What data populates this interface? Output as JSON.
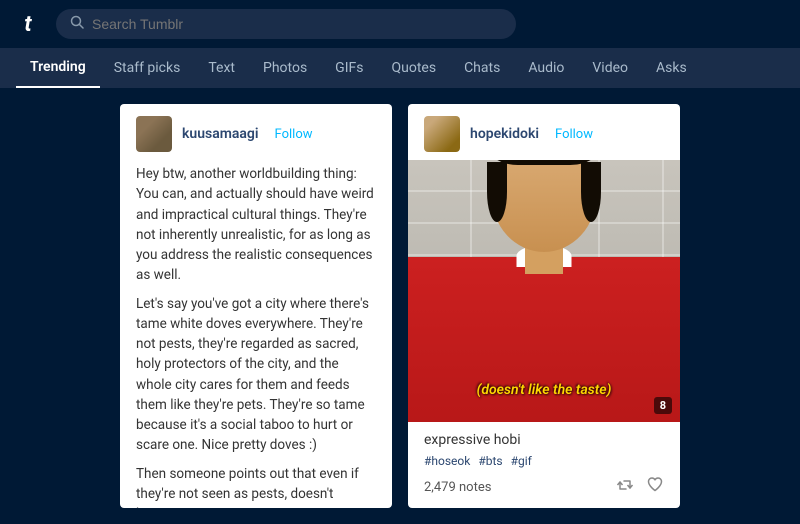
{
  "topbar": {
    "logo": "t",
    "search_placeholder": "Search Tumblr"
  },
  "nav": {
    "items": [
      {
        "label": "Trending",
        "active": true
      },
      {
        "label": "Staff picks",
        "active": false
      },
      {
        "label": "Text",
        "active": false
      },
      {
        "label": "Photos",
        "active": false
      },
      {
        "label": "GIFs",
        "active": false
      },
      {
        "label": "Quotes",
        "active": false
      },
      {
        "label": "Chats",
        "active": false
      },
      {
        "label": "Audio",
        "active": false
      },
      {
        "label": "Video",
        "active": false
      },
      {
        "label": "Asks",
        "active": false
      }
    ]
  },
  "posts": [
    {
      "id": "kuusamaagi-post",
      "username": "kuusamaagi",
      "follow_label": "Follow",
      "paragraphs": [
        "Hey btw, another worldbuilding thing: You can, and actually should have weird and impractical cultural things. They're not inherently unrealistic, for as long as you address the realistic consequences as well.",
        "Let's say you've got a city where there's tame white doves everywhere. They're not pests, they're regarded as sacred, holy protectors of the city, and the whole city cares for them and feeds them like they're pets. They're so tame because it's a social taboo to hurt or scare one. Nice pretty doves :)",
        "Then someone points out that even if they're not seen as pests, doesn't having a"
      ]
    },
    {
      "id": "hopekidoki-post",
      "username": "hopekidoki",
      "follow_label": "Follow",
      "caption": "(doesn't like the taste)",
      "gif_badge": "8",
      "post_title": "expressive hobi",
      "tags": [
        "#hoseok",
        "#bts",
        "#gif"
      ],
      "notes": "2,479 notes"
    }
  ]
}
